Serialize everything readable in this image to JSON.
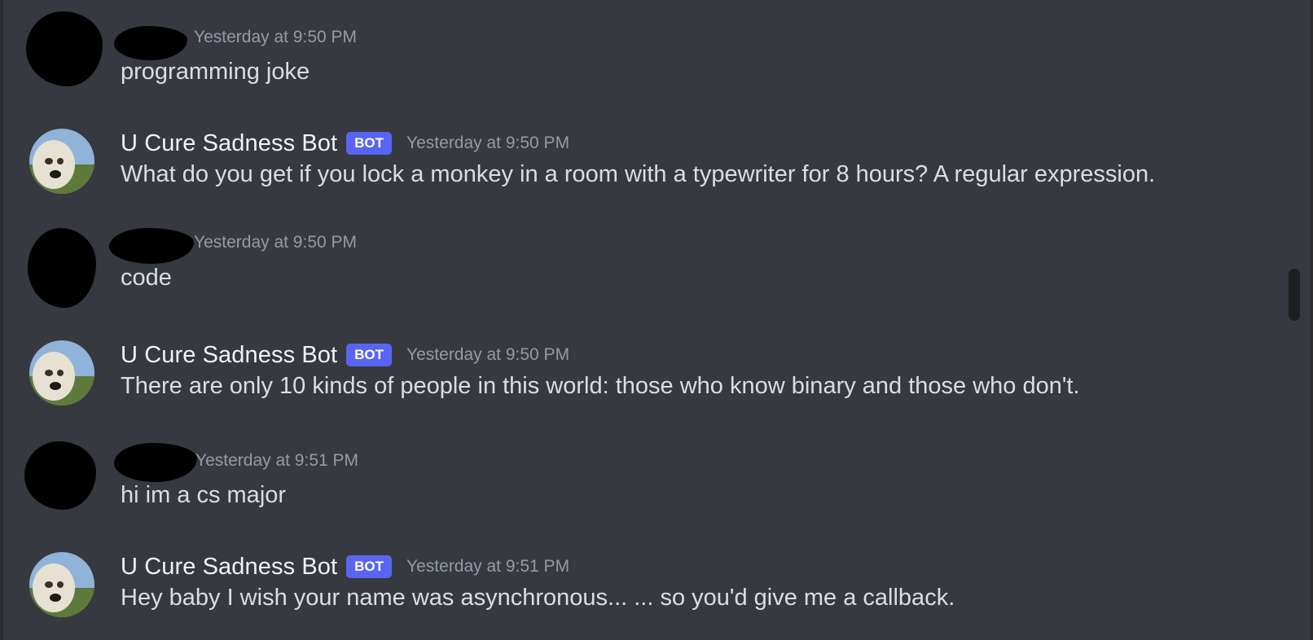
{
  "messages": [
    {
      "author_type": "user",
      "username": "",
      "timestamp": "Yesterday at 9:50 PM",
      "content": "programming joke"
    },
    {
      "author_type": "bot",
      "username": "U Cure Sadness Bot",
      "badge": "BOT",
      "timestamp": "Yesterday at 9:50 PM",
      "content": "What do you get if you lock a monkey in a room with a typewriter for 8 hours? A regular expression."
    },
    {
      "author_type": "user",
      "username": "",
      "timestamp": "Yesterday at 9:50 PM",
      "content": "code"
    },
    {
      "author_type": "bot",
      "username": "U Cure Sadness Bot",
      "badge": "BOT",
      "timestamp": "Yesterday at 9:50 PM",
      "content": "There are only 10 kinds of people in this world: those who know binary and those who don't."
    },
    {
      "author_type": "user",
      "username": "",
      "timestamp": "Yesterday at 9:51 PM",
      "content": "hi im a cs major"
    },
    {
      "author_type": "bot",
      "username": "U Cure Sadness Bot",
      "badge": "BOT",
      "timestamp": "Yesterday at 9:51 PM",
      "content": "Hey baby I wish your name was asynchronous... ... so you'd give me a callback."
    }
  ],
  "colors": {
    "background": "#36393f",
    "username": "#f2f3f5",
    "message_text": "#dbdee1",
    "timestamp": "#949ba4",
    "bot_badge": "#5865f2"
  },
  "icons": {
    "bot_avatar": "dog-avatar-icon",
    "user_avatar": "redacted-avatar"
  }
}
